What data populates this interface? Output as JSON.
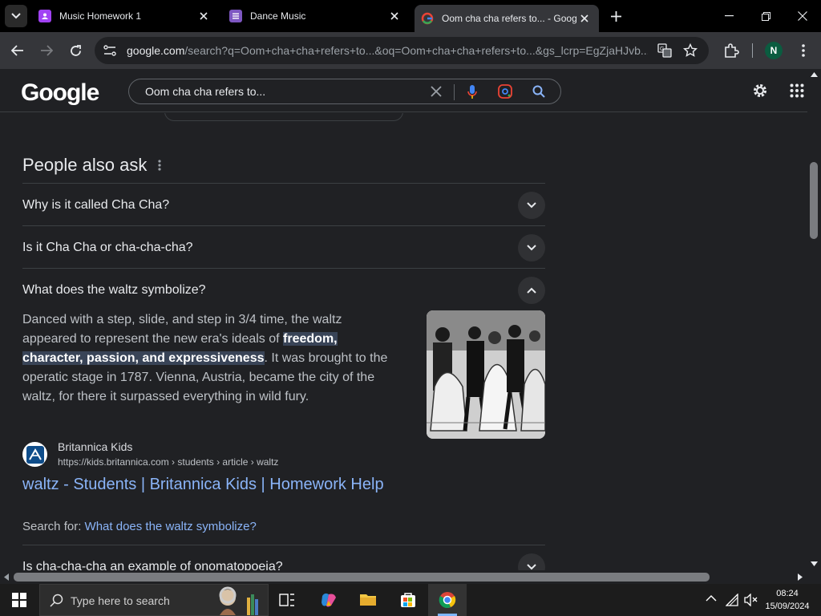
{
  "tabs": [
    {
      "title": "Music Homework 1",
      "favicon": "classroom-icon",
      "color": "#a142f4"
    },
    {
      "title": "Dance Music",
      "favicon": "forms-icon",
      "color": "#7e57c2"
    },
    {
      "title": "Oom cha cha refers to... - Goog",
      "favicon": "google-icon",
      "active": true
    }
  ],
  "address_bar": {
    "host": "google.com",
    "path": "/search?q=Oom+cha+cha+refers+to...&oq=Oom+cha+cha+refers+to...&gs_lcrp=EgZjaHJvb..."
  },
  "profile_initial": "N",
  "google": {
    "logo": "Google",
    "query": "Oom cha cha refers to..."
  },
  "paa": {
    "heading": "People also ask",
    "questions": [
      "Why is it called Cha Cha?",
      "Is it Cha Cha or cha-cha-cha?",
      "What does the waltz symbolize?",
      "Is cha-cha-cha an example of onomatopoeia?"
    ],
    "answer": {
      "before": "Danced with a step, slide, and step in 3/4 time, the waltz appeared to represent the new era's ideals of ",
      "highlight": "freedom, character, passion, and expressiveness",
      "after": ". It was brought to the operatic stage in 1787. Vienna, Austria, became the city of the waltz, for there it surpassed everything in wild fury."
    },
    "source": {
      "site": "Britannica Kids",
      "url": "https://kids.britannica.com › students › article › waltz",
      "title": "waltz - Students | Britannica Kids | Homework Help"
    },
    "search_for_label": "Search for:",
    "search_for_query": "What does the waltz symbolize?"
  },
  "taskbar": {
    "search_placeholder": "Type here to search",
    "time": "08:24",
    "date": "15/09/2024"
  },
  "colors": {
    "link": "#8ab4f8",
    "highlight_bg": "#394457",
    "profile_bg": "#0b5c40"
  }
}
